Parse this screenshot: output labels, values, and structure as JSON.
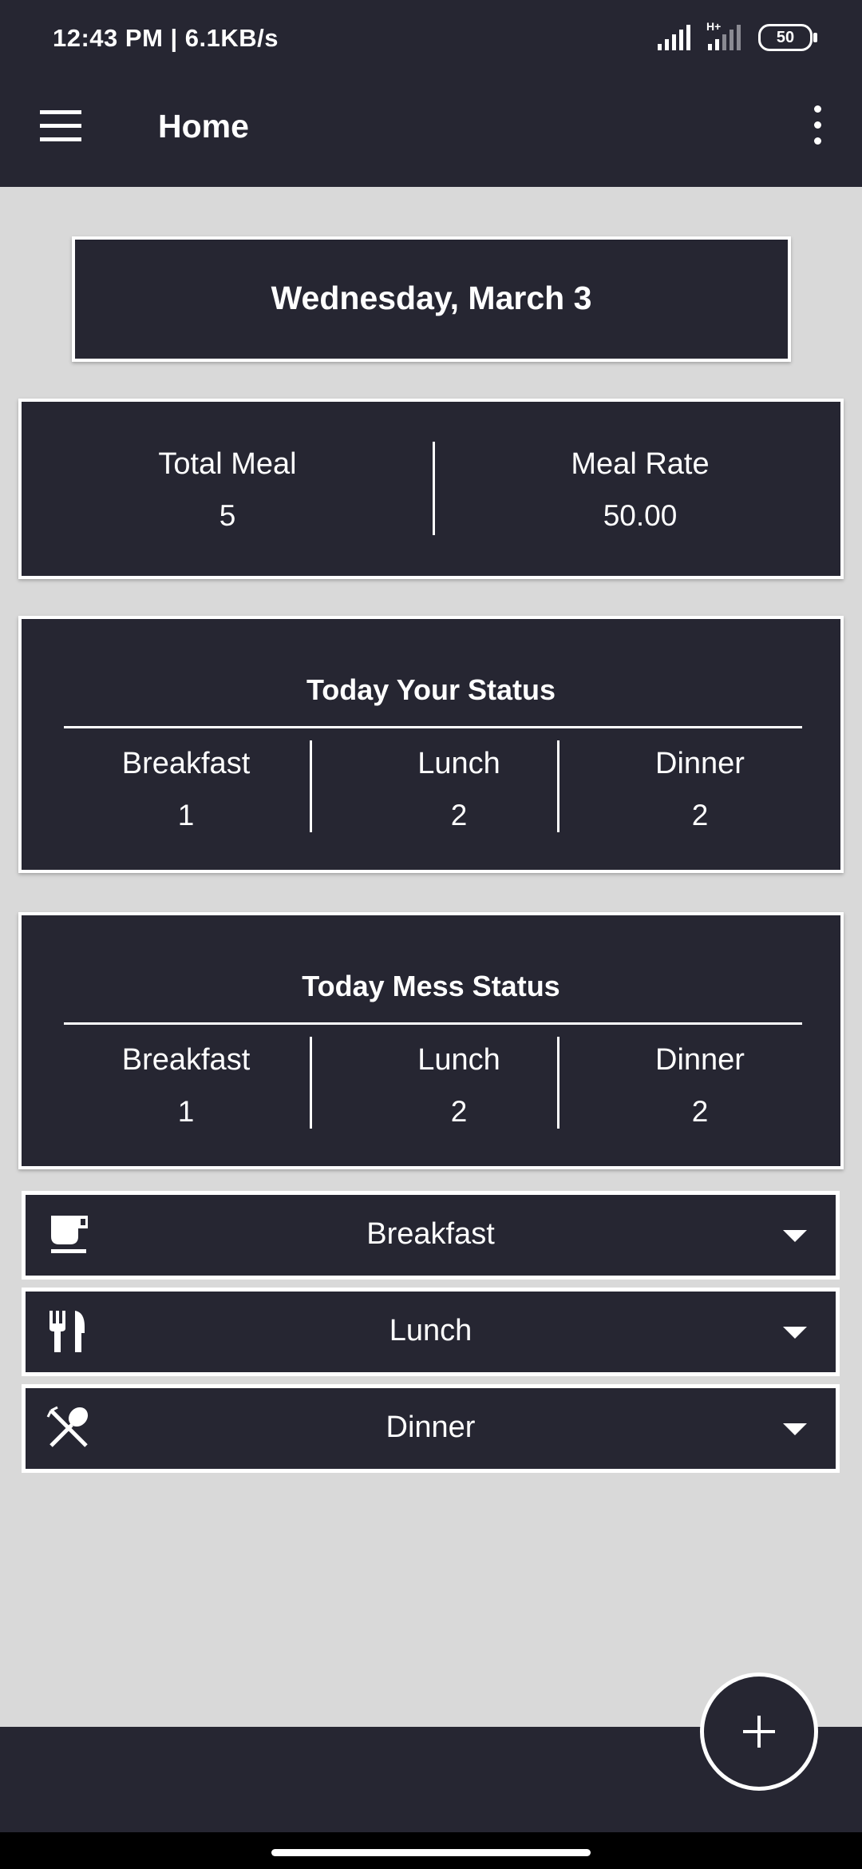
{
  "status_bar": {
    "time_speed": "12:43 PM | 6.1KB/s",
    "network_label": "H+",
    "battery": "50"
  },
  "app_bar": {
    "title": "Home",
    "menu_icon": "hamburger-menu-icon",
    "more_icon": "more-vert-icon"
  },
  "date_card": {
    "text": "Wednesday, March 3"
  },
  "summary": {
    "total_meal_label": "Total Meal",
    "total_meal_value": "5",
    "meal_rate_label": "Meal Rate",
    "meal_rate_value": "50.00"
  },
  "your_status": {
    "title": "Today Your Status",
    "items": [
      {
        "label": "Breakfast",
        "value": "1"
      },
      {
        "label": "Lunch",
        "value": "2"
      },
      {
        "label": "Dinner",
        "value": "2"
      }
    ]
  },
  "mess_status": {
    "title": "Today Mess Status",
    "items": [
      {
        "label": "Breakfast",
        "value": "1"
      },
      {
        "label": "Lunch",
        "value": "2"
      },
      {
        "label": "Dinner",
        "value": "2"
      }
    ]
  },
  "meals": [
    {
      "label": "Breakfast",
      "icon": "coffee-cup-icon"
    },
    {
      "label": "Lunch",
      "icon": "fork-knife-icon"
    },
    {
      "label": "Dinner",
      "icon": "fork-spoon-crossed-icon"
    }
  ],
  "fab": {
    "icon": "plus-icon"
  },
  "colors": {
    "dark": "#262632",
    "background": "#d9d9d9",
    "foreground": "#ffffff"
  }
}
